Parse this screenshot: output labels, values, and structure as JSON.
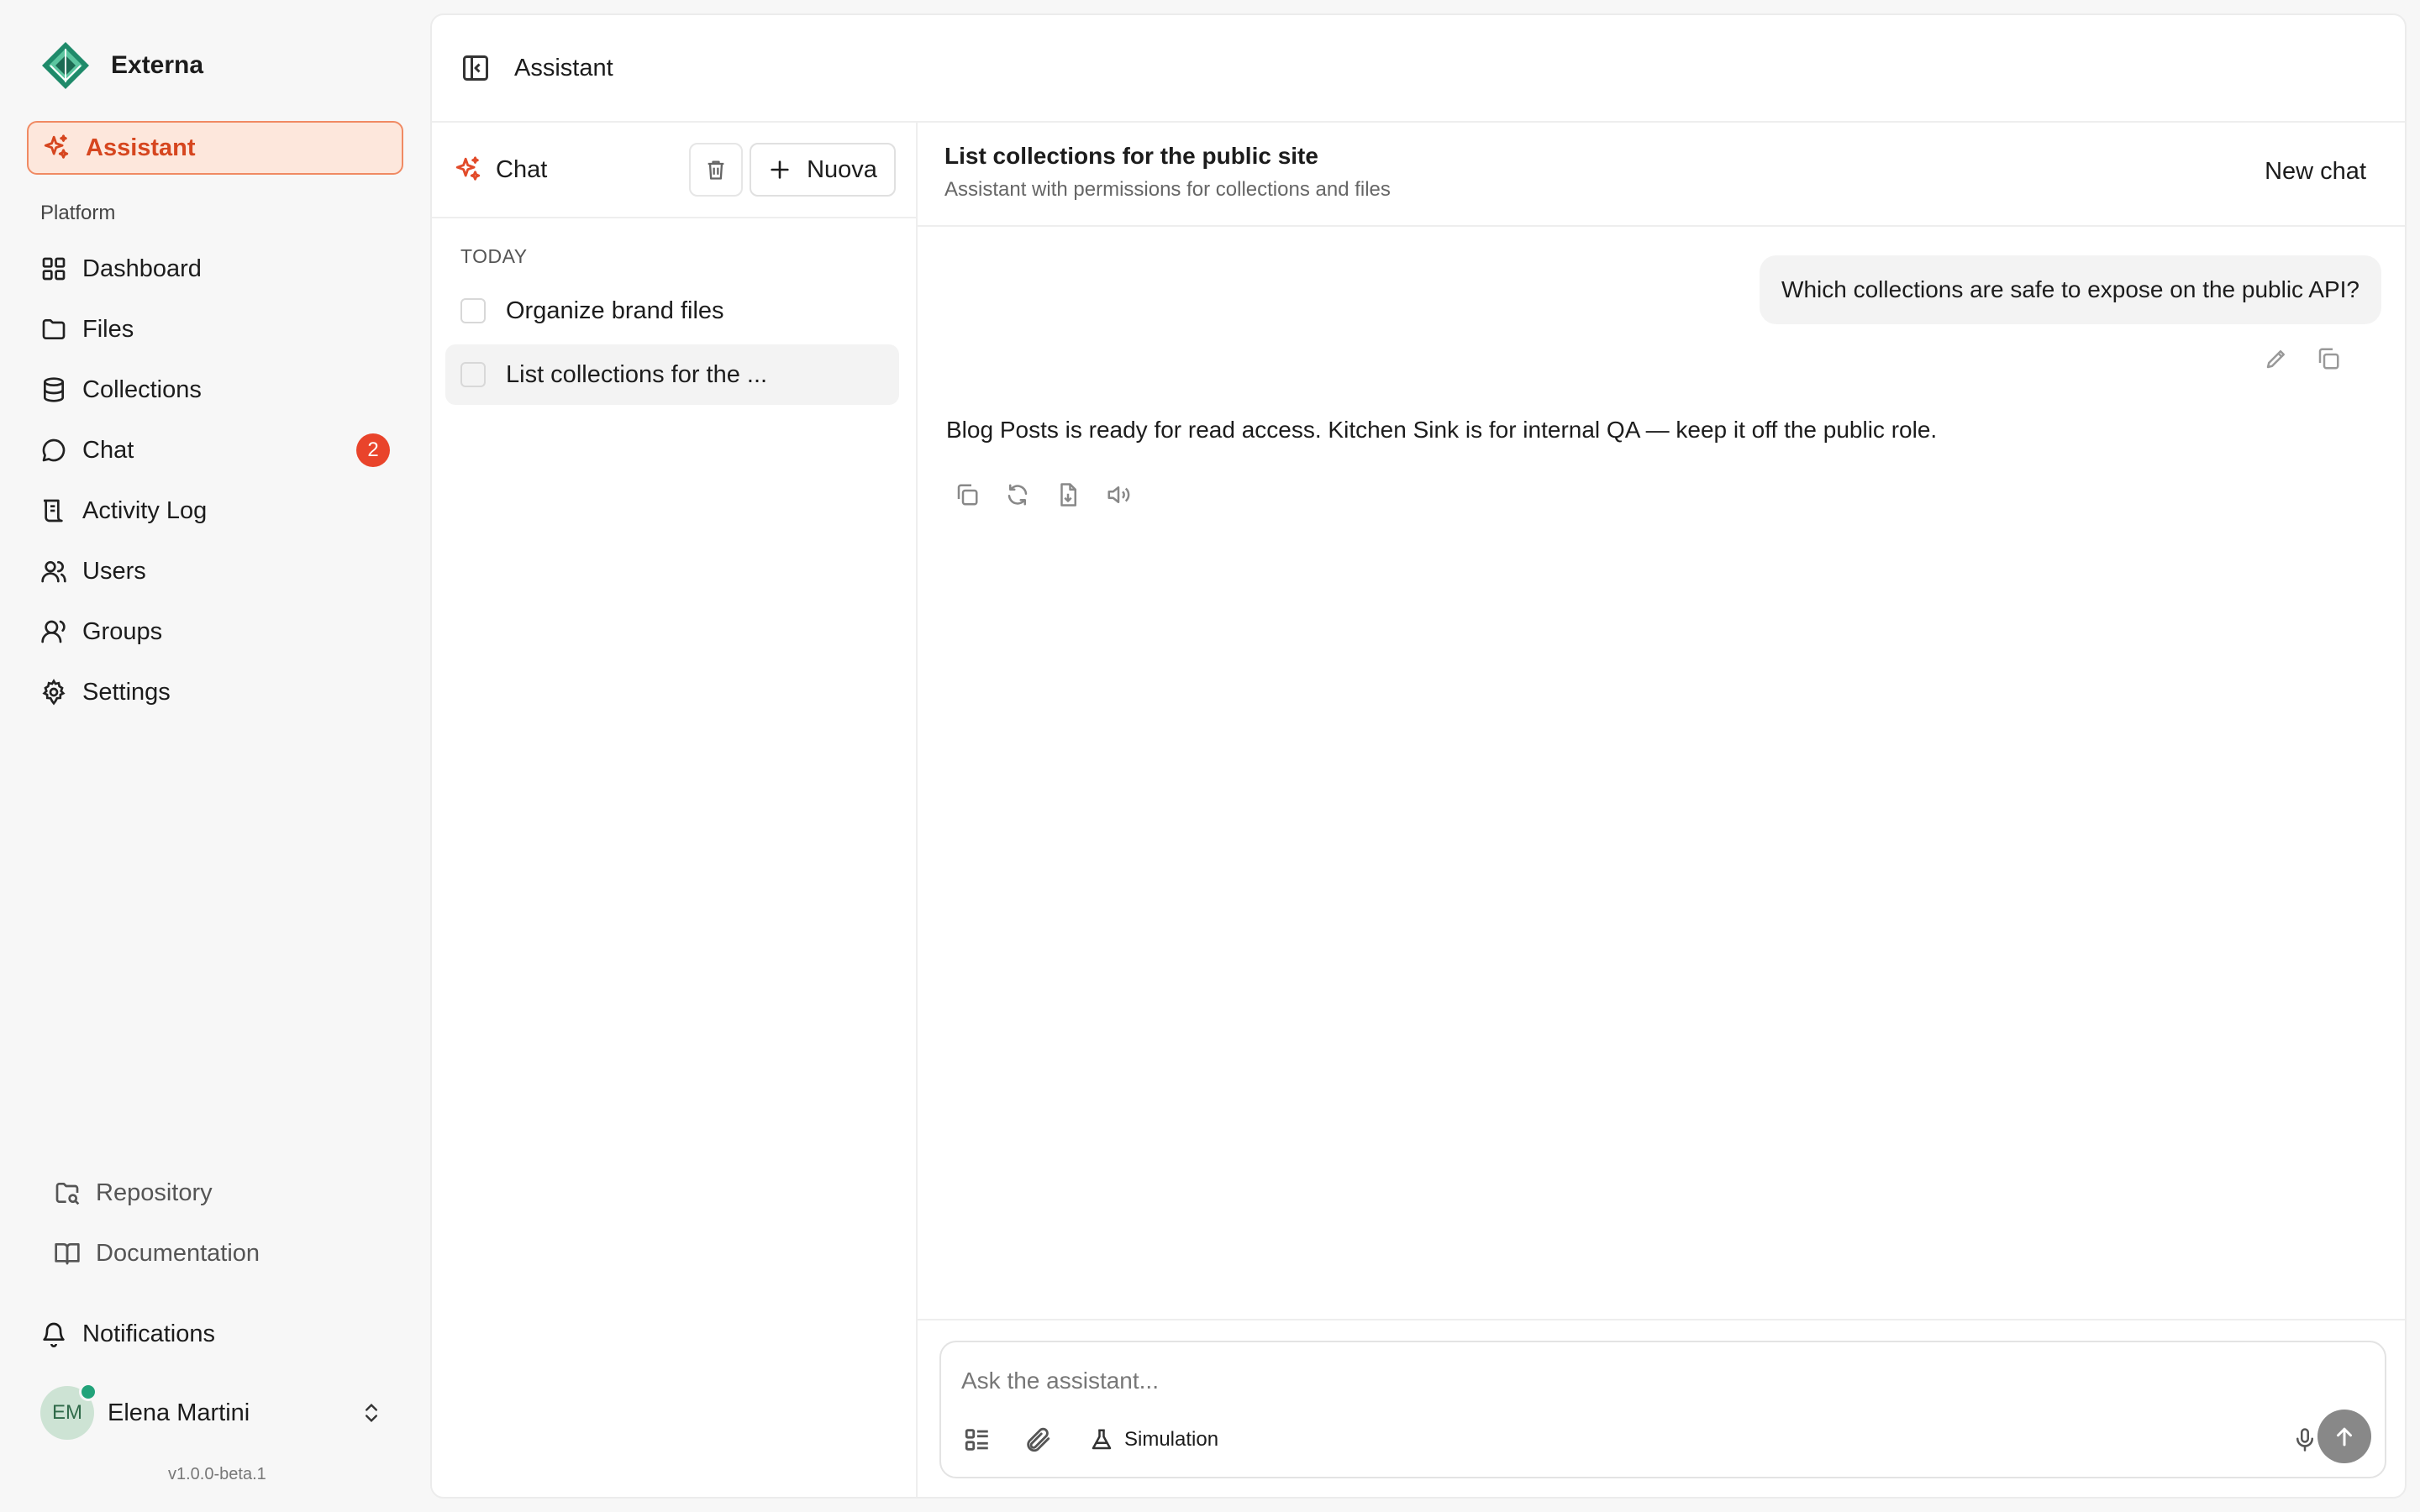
{
  "brand": {
    "name": "Externa"
  },
  "sidebar": {
    "assistant_label": "Assistant",
    "section_label": "Platform",
    "items": [
      {
        "label": "Dashboard",
        "icon": "dashboard-icon"
      },
      {
        "label": "Files",
        "icon": "folder-icon"
      },
      {
        "label": "Collections",
        "icon": "database-icon"
      },
      {
        "label": "Chat",
        "icon": "chat-bubble-icon",
        "badge": "2"
      },
      {
        "label": "Activity Log",
        "icon": "log-icon"
      },
      {
        "label": "Users",
        "icon": "users-icon"
      },
      {
        "label": "Groups",
        "icon": "groups-icon"
      },
      {
        "label": "Settings",
        "icon": "gear-icon"
      }
    ],
    "footer_links": [
      {
        "label": "Repository",
        "icon": "repository-icon"
      },
      {
        "label": "Documentation",
        "icon": "book-icon"
      }
    ],
    "notifications_label": "Notifications",
    "user": {
      "initials": "EM",
      "name": "Elena Martini"
    },
    "version": "v1.0.0-beta.1",
    "accent_color": "#d6461f",
    "badge_color": "#e9442b"
  },
  "topbar": {
    "title": "Assistant"
  },
  "chat_list": {
    "title": "Chat",
    "new_label": "Nuova",
    "group_label": "TODAY",
    "threads": [
      {
        "title": "Organize brand files",
        "active": false
      },
      {
        "title": "List collections for the ...",
        "active": true
      }
    ]
  },
  "conversation": {
    "title": "List collections for the public site",
    "subtitle": "Assistant with permissions for collections and files",
    "new_chat_label": "New chat",
    "messages": [
      {
        "role": "user",
        "text": "Which collections are safe to expose on the public API?"
      },
      {
        "role": "assistant",
        "text": "Blog Posts is ready for read access. Kitchen Sink is for internal QA — keep it off the public role."
      }
    ]
  },
  "composer": {
    "placeholder": "Ask the assistant...",
    "simulation_label": "Simulation"
  }
}
